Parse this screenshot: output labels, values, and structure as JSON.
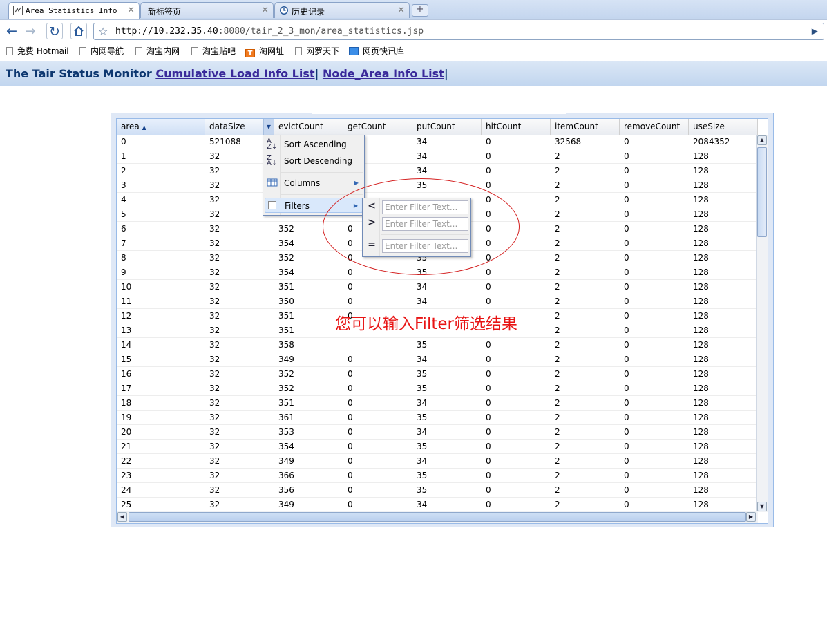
{
  "browser": {
    "tabs": [
      {
        "label": "Area Statistics Info",
        "close": "×"
      },
      {
        "label": "新标签页",
        "close": "×"
      },
      {
        "label": "历史记录",
        "close": "×"
      }
    ],
    "new_tab": "+",
    "url_host": "http://10.232.35.40",
    "url_rest": ":8080/tair_2_3_mon/area_statistics.jsp",
    "bookmarks": [
      {
        "label": "免费 Hotmail",
        "icon": "page-icon"
      },
      {
        "label": "内网导航",
        "icon": "page-icon"
      },
      {
        "label": "淘宝内网",
        "icon": "page-icon"
      },
      {
        "label": "淘宝贴吧",
        "icon": "page-icon"
      },
      {
        "label": "淘网址",
        "icon": "orange-t-icon"
      },
      {
        "label": "网罗天下",
        "icon": "page-icon"
      },
      {
        "label": "网页快讯库",
        "icon": "blue-e-icon"
      }
    ]
  },
  "header": {
    "title": "The Tair Status Monitor",
    "link1": "Cumulative Load Info List",
    "sep": "|",
    "link2": "Node_Area Info List",
    "sep2": "|"
  },
  "grid": {
    "columns": [
      "area",
      "dataSize",
      "evictCount",
      "getCount",
      "putCount",
      "hitCount",
      "itemCount",
      "removeCount",
      "useSize"
    ],
    "rows": [
      [
        "0",
        "521088",
        "",
        "",
        "34",
        "0",
        "32568",
        "0",
        "2084352"
      ],
      [
        "1",
        "32",
        "",
        "",
        "34",
        "0",
        "2",
        "0",
        "128"
      ],
      [
        "2",
        "32",
        "",
        "",
        "34",
        "0",
        "2",
        "0",
        "128"
      ],
      [
        "3",
        "32",
        "",
        "",
        "35",
        "0",
        "2",
        "0",
        "128"
      ],
      [
        "4",
        "32",
        "",
        "",
        "",
        "0",
        "2",
        "0",
        "128"
      ],
      [
        "5",
        "32",
        "",
        "",
        "",
        "0",
        "2",
        "0",
        "128"
      ],
      [
        "6",
        "32",
        "352",
        "0",
        "",
        "0",
        "2",
        "0",
        "128"
      ],
      [
        "7",
        "32",
        "354",
        "0",
        "",
        "0",
        "2",
        "0",
        "128"
      ],
      [
        "8",
        "32",
        "352",
        "0",
        "35",
        "0",
        "2",
        "0",
        "128"
      ],
      [
        "9",
        "32",
        "354",
        "0",
        "35",
        "0",
        "2",
        "0",
        "128"
      ],
      [
        "10",
        "32",
        "351",
        "0",
        "34",
        "0",
        "2",
        "0",
        "128"
      ],
      [
        "11",
        "32",
        "350",
        "0",
        "34",
        "0",
        "2",
        "0",
        "128"
      ],
      [
        "12",
        "32",
        "351",
        "0",
        "",
        "",
        "2",
        "0",
        "128"
      ],
      [
        "13",
        "32",
        "351",
        "",
        "",
        "",
        "2",
        "0",
        "128"
      ],
      [
        "14",
        "32",
        "358",
        "",
        "35",
        "0",
        "2",
        "0",
        "128"
      ],
      [
        "15",
        "32",
        "349",
        "0",
        "34",
        "0",
        "2",
        "0",
        "128"
      ],
      [
        "16",
        "32",
        "352",
        "0",
        "35",
        "0",
        "2",
        "0",
        "128"
      ],
      [
        "17",
        "32",
        "352",
        "0",
        "35",
        "0",
        "2",
        "0",
        "128"
      ],
      [
        "18",
        "32",
        "351",
        "0",
        "34",
        "0",
        "2",
        "0",
        "128"
      ],
      [
        "19",
        "32",
        "361",
        "0",
        "35",
        "0",
        "2",
        "0",
        "128"
      ],
      [
        "20",
        "32",
        "353",
        "0",
        "34",
        "0",
        "2",
        "0",
        "128"
      ],
      [
        "21",
        "32",
        "354",
        "0",
        "35",
        "0",
        "2",
        "0",
        "128"
      ],
      [
        "22",
        "32",
        "349",
        "0",
        "34",
        "0",
        "2",
        "0",
        "128"
      ],
      [
        "23",
        "32",
        "366",
        "0",
        "35",
        "0",
        "2",
        "0",
        "128"
      ],
      [
        "24",
        "32",
        "356",
        "0",
        "35",
        "0",
        "2",
        "0",
        "128"
      ],
      [
        "25",
        "32",
        "349",
        "0",
        "34",
        "0",
        "2",
        "0",
        "128"
      ]
    ]
  },
  "column_menu": {
    "sort_asc": "Sort Ascending",
    "sort_desc": "Sort Descending",
    "columns": "Columns",
    "filters": "Filters"
  },
  "filter_menu": {
    "lt_symbol": "<",
    "gt_symbol": ">",
    "eq_symbol": "=",
    "placeholder": "Enter Filter Text..."
  },
  "annotation": "您可以输入Filter筛选结果",
  "colors": {
    "annotation": "#e81414",
    "header_text": "#0d3770",
    "link": "#3a2a9a"
  }
}
